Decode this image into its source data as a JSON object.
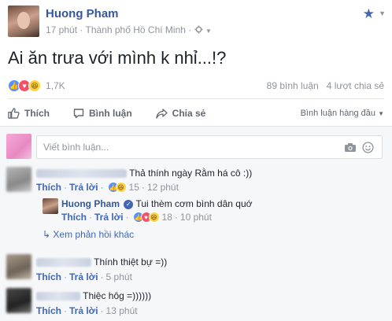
{
  "post": {
    "author": "Huong Pham",
    "time": "17 phút",
    "location": "Thành phố Hồ Chí Minh",
    "status_text": "Ai ăn trưa với mình k nhỉ...!?"
  },
  "reactions": {
    "count": "1,7K",
    "comments": "89 bình luận",
    "shares": "4 lượt chia sẻ"
  },
  "actions": {
    "like": "Thích",
    "comment": "Bình luận",
    "share": "Chia sẻ",
    "sort": "Bình luận hàng đầu"
  },
  "comment_input": {
    "placeholder": "Viết bình luận..."
  },
  "comments": [
    {
      "text": "Thả thính ngày Rằm há cô :))",
      "like": "Thích",
      "reply": "Trả lời",
      "reactions": "15",
      "time": "12 phút",
      "replies": [
        {
          "author": "Huong Pham",
          "text": "Tui thèm cơm bình dân quớ",
          "like": "Thích",
          "reply": "Trả lời",
          "reactions": "18",
          "time": "10 phút"
        }
      ],
      "more_replies": "Xem phản hồi khác"
    },
    {
      "text": "Thính thiệt bự =))",
      "like": "Thích",
      "reply": "Trả lời",
      "time": "5 phút"
    },
    {
      "text": "Thiệc hôg =))))))",
      "like": "Thích",
      "reply": "Trả lời",
      "time": "13 phút"
    }
  ],
  "colors": {
    "link": "#4267b2",
    "author": "#365899",
    "muted": "#90949c",
    "comments_bg": "#f6f7f9"
  }
}
